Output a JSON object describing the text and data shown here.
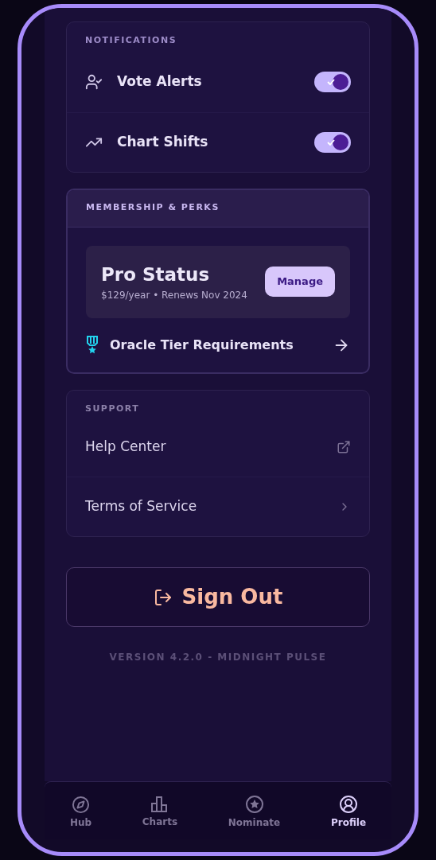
{
  "notifications": {
    "title": "NOTIFICATIONS",
    "items": [
      {
        "label": "Vote Alerts",
        "on": true
      },
      {
        "label": "Chart Shifts",
        "on": true
      }
    ]
  },
  "membership": {
    "title": "MEMBERSHIP & PERKS",
    "plan": "Pro Status",
    "details": "$129/year • Renews Nov 2024",
    "button": "Manage",
    "link": "Oracle Tier Requirements"
  },
  "support": {
    "title": "SUPPORT",
    "items": [
      {
        "label": "Help Center",
        "kind": "external"
      },
      {
        "label": "Terms of Service",
        "kind": "chevron"
      }
    ]
  },
  "sign_out": "Sign Out",
  "version": "VERSION 4.2.0 - MIDNIGHT PULSE",
  "nav": [
    {
      "label": "Hub",
      "selected": false
    },
    {
      "label": "Charts",
      "selected": false
    },
    {
      "label": "Nominate",
      "selected": false
    },
    {
      "label": "Profile",
      "selected": true
    }
  ]
}
